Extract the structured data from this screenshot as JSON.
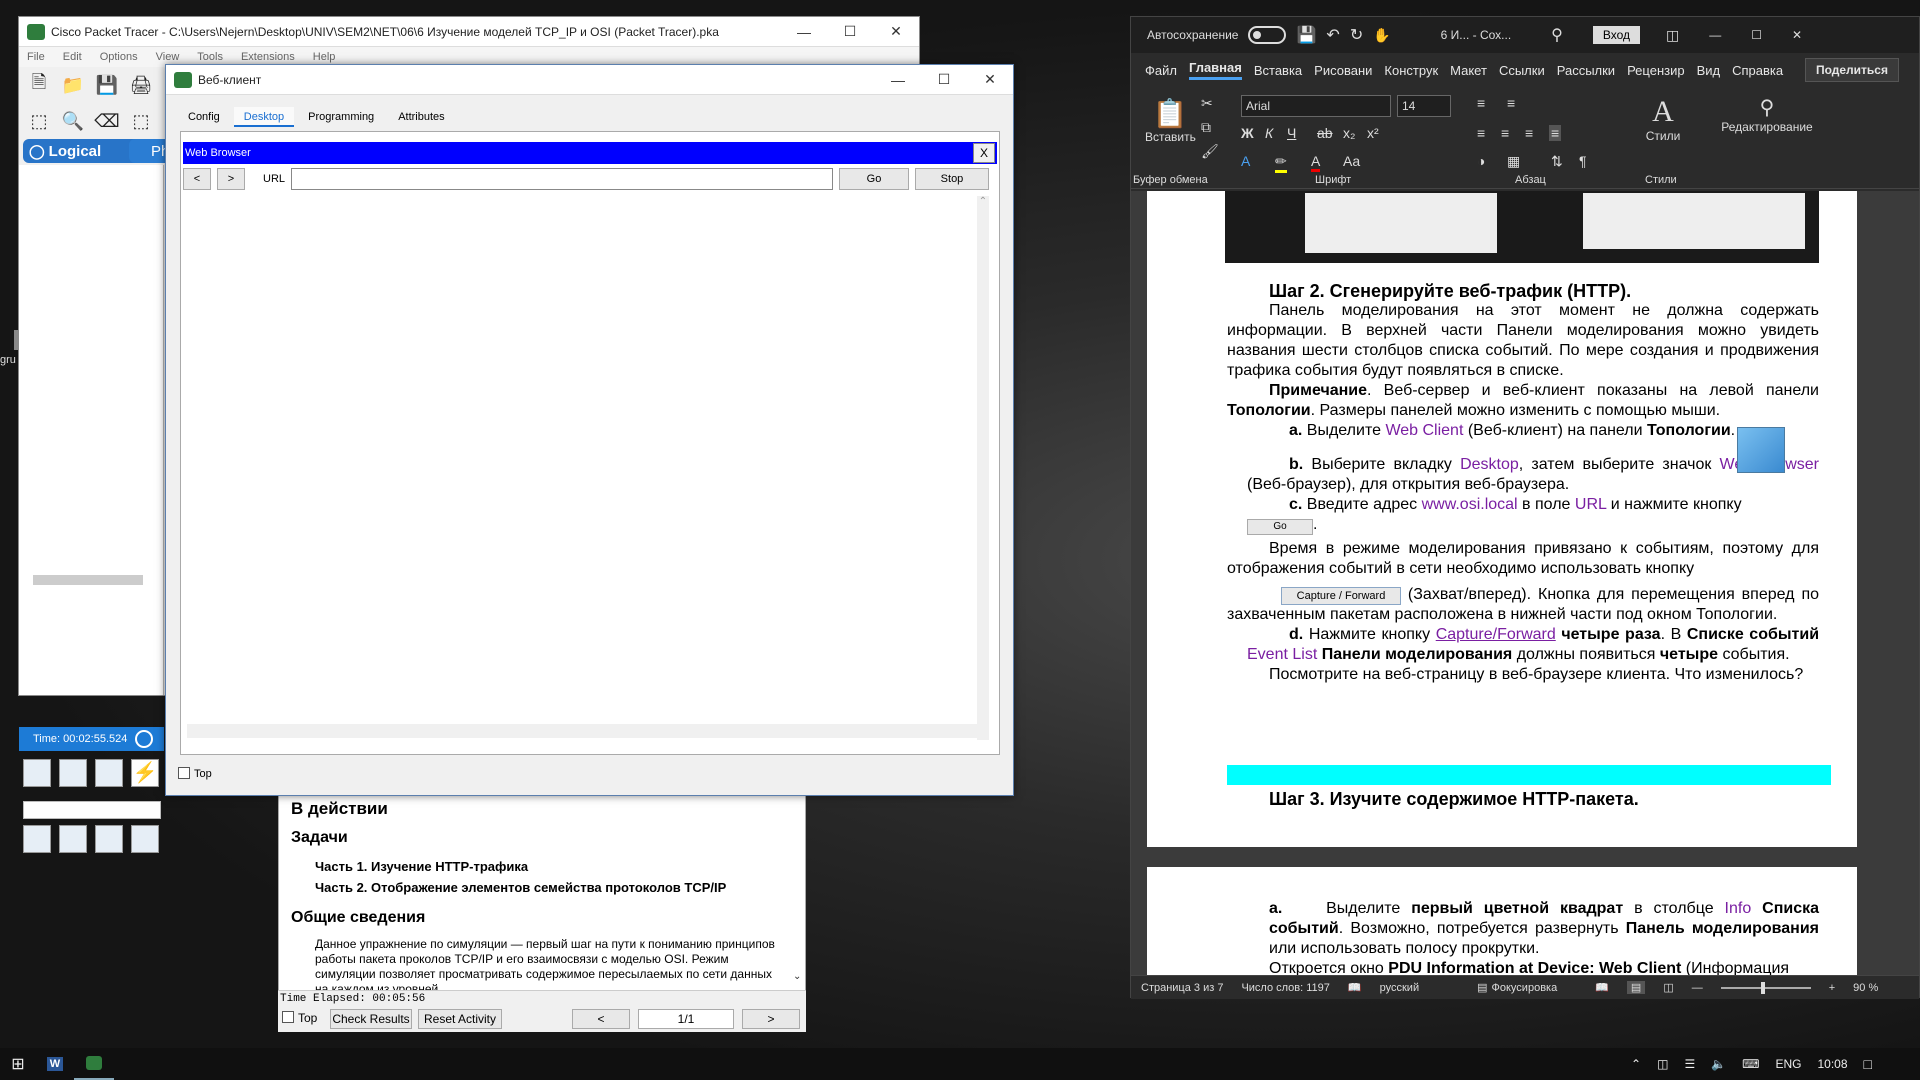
{
  "packet_tracer": {
    "title": "Cisco Packet Tracer - C:\\Users\\Nejern\\Desktop\\UNIV\\SEM2\\NET\\06\\6 Изучение моделей TCP_IP и OSI (Packet Tracer).pka",
    "menu": [
      "File",
      "Edit",
      "Options",
      "View",
      "Tools",
      "Extensions",
      "Help"
    ],
    "logical_label": "Logical",
    "physical_label": "Phys",
    "time_label": "Time: 00:02:55.524"
  },
  "desktop": {
    "icon_label": "gru"
  },
  "instructions": {
    "heading": "В действии",
    "tasks_heading": "Задачи",
    "part1": "Часть 1. Изучение HTTP-трафика",
    "part2": "Часть 2. Отображение элементов семейства протоколов TCP/IP",
    "general_heading": "Общие сведения",
    "general_text": "Данное упражнение по симуляции — первый шаг на пути к пониманию принципов работы пакета проколов TCP/IP и его взаимосвязи с моделью OSI. Режим симуляции позволяет просматривать содержимое пересылаемых по сети данных на каждом из уровней.",
    "time_elapsed": "Time Elapsed: 00:05:56",
    "top_label": "Top",
    "check_results": "Check Results",
    "reset_activity": "Reset Activity",
    "prev": "<",
    "page": "1/1",
    "next": ">"
  },
  "web_client": {
    "title": "Веб-клиент",
    "tabs": [
      "Config",
      "Desktop",
      "Programming",
      "Attributes"
    ],
    "browser_title": "Web Browser",
    "close_label": "X",
    "back": "<",
    "forward": ">",
    "url_label": "URL",
    "url_value": "",
    "go": "Go",
    "stop": "Stop",
    "top_label": "Top"
  },
  "word": {
    "autosave": "Автосохранение",
    "doc_title": "6 И... - Сох...",
    "signin": "Вход",
    "tabs": [
      "Файл",
      "Главная",
      "Вставка",
      "Рисовани",
      "Конструк",
      "Макет",
      "Ссылки",
      "Рассылки",
      "Рецензир",
      "Вид",
      "Справка"
    ],
    "share": "Поделиться",
    "paste": "Вставить",
    "font_name": "Arial",
    "font_size": "14",
    "styles": "Стили",
    "editing": "Редактирование",
    "groups": [
      "Буфер обмена",
      "Шрифт",
      "Абзац",
      "Стили"
    ],
    "doc": {
      "step2": "Шаг 2. Сгенерируйте веб-трафик (HTTP).",
      "step2_strike": "Сгенерируйте",
      "p1": "Панель моделирования на этот момент не должна содержать информации. В верхней части Панели моделирования можно увидеть названия шести столбцов списка событий. По мере создания и продвижения трафика события будут появляться в списке.",
      "note_bold": "Примечание",
      "note": ". Веб-сервер и веб-клиент показаны на левой панели ",
      "note_topo": "Топологии",
      "note_end": ". Размеры панелей можно изменить с помощью мыши.",
      "a_label": "a.",
      "a_text1": "Выделите ",
      "a_link": "Web Client",
      "a_text2": " (Веб-клиент) на панели ",
      "a_bold": "Топологии",
      "b_label": "b.",
      "b_text1": "Выберите вкладку ",
      "b_link1": "Desktop",
      "b_text2": ", затем выберите значок ",
      "b_link2": "Web Browser",
      "b_text3": " (Веб-браузер), для открытия веб-браузера.",
      "c_label": "c.",
      "c_text1": "Введите адрес ",
      "c_link1": "www.osi.local",
      "c_text2": " в поле ",
      "c_link2": "URL",
      "c_text3": " и нажмите кнопку",
      "go_img": "Go",
      "p2": "Время в режиме моделирования привязано к событиям, поэтому для отображения событий в сети необходимо использовать кнопку",
      "capture_img": "Capture / Forward",
      "p2b": " (Захват/вперед). Кнопка для перемещения вперед по захваченным пакетам расположена в нижней части под окном Топологии.",
      "d_label": "d.",
      "d_text1": "Нажмите кнопку ",
      "d_link": "Capture/Forward",
      "d_bold1": " четыре раза",
      "d_text2": ". В ",
      "d_bold2": "Списке событий",
      "d_link2": " Event List",
      "d_bold3": " Панели моделирования",
      "d_text3": " должны появиться ",
      "d_bold4": "четыре",
      "d_text4": " события.",
      "p3": "Посмотрите на веб-страницу в веб-браузере клиента. Что изменилось?",
      "step3": "Шаг 3. Изучите содержимое HTTP-пакета.",
      "pa_label": "a.",
      "pa_text1": "Выделите ",
      "pa_bold1": "первый цветной квадрат",
      "pa_text2": " в столбце ",
      "pa_link": "Info",
      "pa_bold2": " Списка событий",
      "pa_text3": ". Возможно, потребуется развернуть ",
      "pa_bold3": "Панель моделирования",
      "pa_text4": " или использовать полосу прокрутки.",
      "p4_1": "Откроется окно ",
      "p4_bold": "PDU Information at Device: Web Client",
      "p4_2": " (Информация"
    },
    "status": {
      "page": "Страница 3 из 7",
      "words": "Число слов: 1197",
      "lang": "русский",
      "focus": "Фокусировка",
      "zoom": "90 %"
    }
  },
  "taskbar": {
    "lang": "ENG",
    "time": "10:08"
  }
}
